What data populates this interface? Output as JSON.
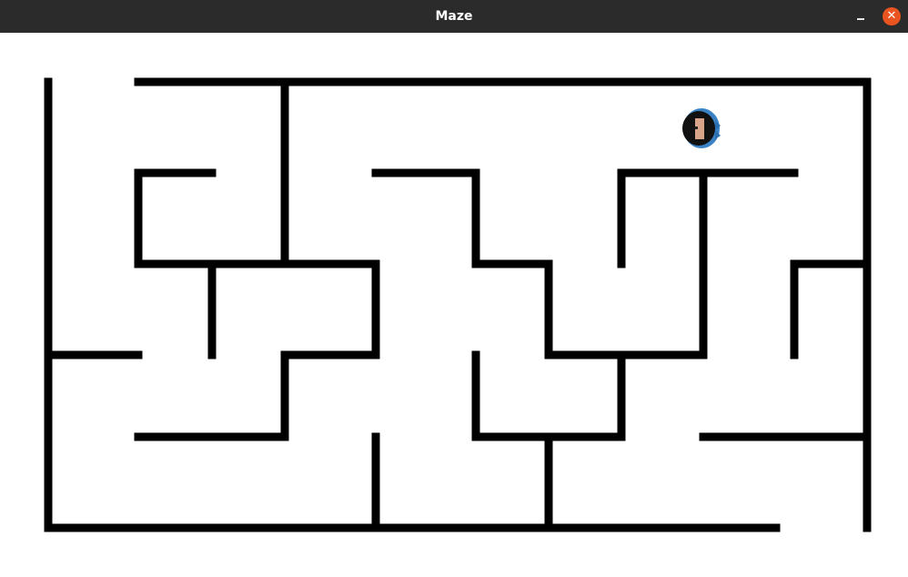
{
  "window": {
    "title": "Maze",
    "close_glyph": "✕",
    "minimize_icon": "minimize-icon",
    "close_icon": "close-icon",
    "close_color": "#e95420",
    "titlebar_color": "#2b2b2b"
  },
  "maze": {
    "wall_color": "#000000",
    "background_color": "#ffffff",
    "player_icon": "player-sprite-icon"
  }
}
